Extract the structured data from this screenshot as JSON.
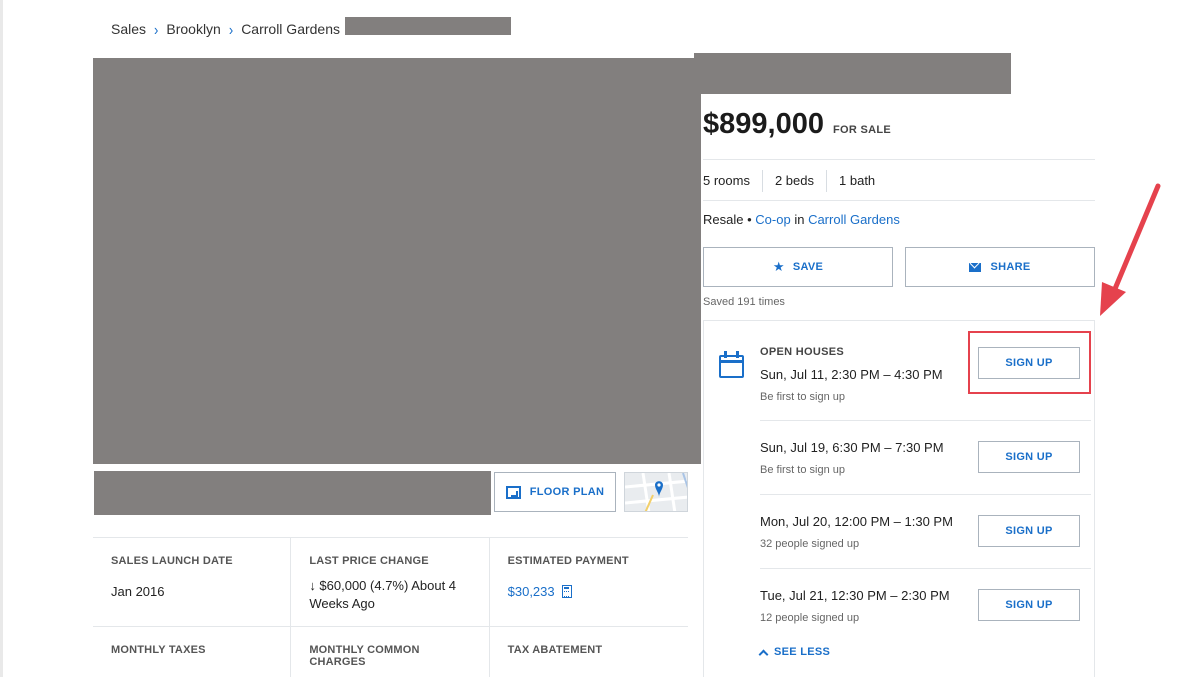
{
  "breadcrumb": {
    "items": [
      "Sales",
      "Brooklyn",
      "Carroll Gardens"
    ]
  },
  "gallery": {
    "floor_plan_label": "FLOOR PLAN"
  },
  "details": {
    "sales_launch_date": {
      "label": "SALES LAUNCH DATE",
      "value": "Jan 2016"
    },
    "last_price_change": {
      "label": "LAST PRICE CHANGE",
      "value": "↓ $60,000 (4.7%) About 4 Weeks Ago"
    },
    "estimated_payment": {
      "label": "ESTIMATED PAYMENT",
      "value": "$30,233"
    },
    "monthly_taxes": {
      "label": "MONTHLY TAXES"
    },
    "monthly_common_charges": {
      "label": "MONTHLY COMMON CHARGES"
    },
    "tax_abatement": {
      "label": "TAX ABATEMENT"
    }
  },
  "listing": {
    "price": "$899,000",
    "status": "FOR SALE",
    "rooms": "5 rooms",
    "beds": "2 beds",
    "baths": "1 bath",
    "type_prefix": "Resale •",
    "type_link": "Co-op",
    "type_in": "in",
    "neighborhood_link": "Carroll Gardens",
    "save_label": "SAVE",
    "share_label": "SHARE",
    "saved_count": "Saved 191 times"
  },
  "open_houses": {
    "title": "OPEN HOUSES",
    "signup_label": "SIGN UP",
    "see_less_label": "SEE LESS",
    "events": [
      {
        "date": "Sun, Jul 11, 2:30 PM – 4:30 PM",
        "note": "Be first to sign up"
      },
      {
        "date": "Sun, Jul 19, 6:30 PM – 7:30 PM",
        "note": "Be first to sign up"
      },
      {
        "date": "Mon, Jul 20, 12:00 PM – 1:30 PM",
        "note": "32 people signed up"
      },
      {
        "date": "Tue, Jul 21, 12:30 PM – 2:30 PM",
        "note": "12 people signed up"
      }
    ]
  },
  "annotation": {
    "color": "#e5424d"
  },
  "colors": {
    "accent": "#1a6fc9",
    "redaction": "#827f7e"
  }
}
